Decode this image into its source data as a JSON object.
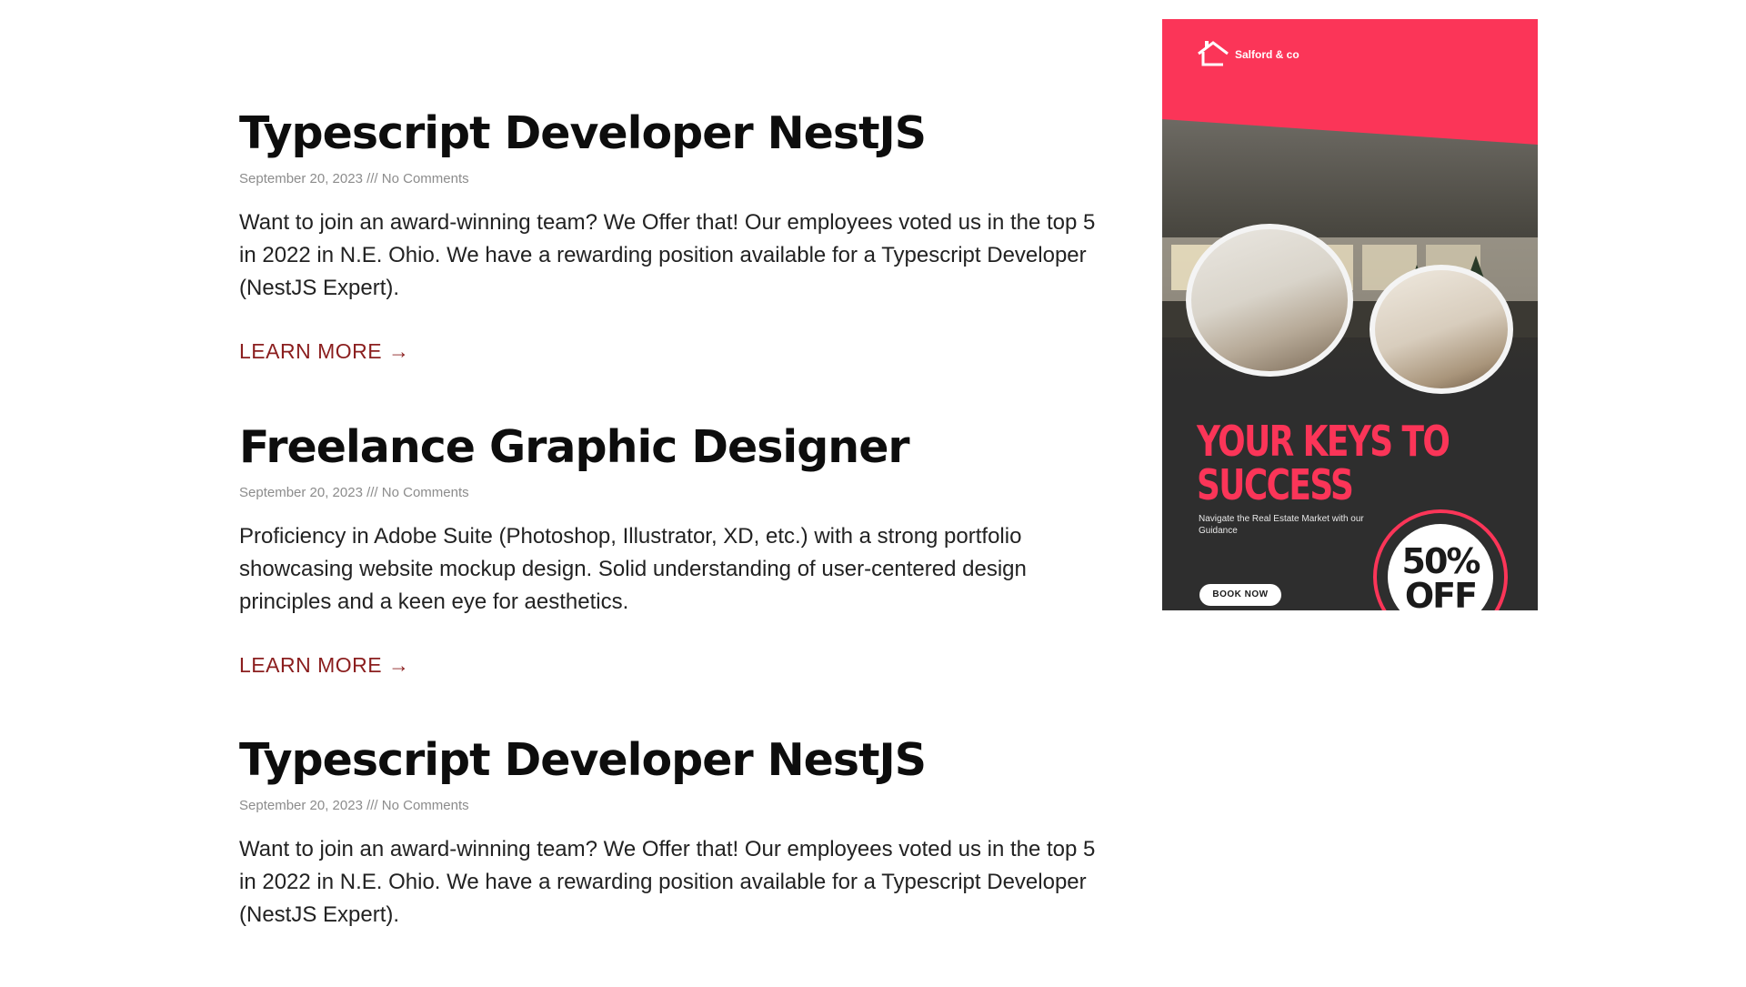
{
  "posts": [
    {
      "title": "Typescript Developer NestJS",
      "meta": "September 20, 2023 /// No Comments",
      "excerpt": "Want to join an award-winning team? We Offer that! Our employees voted us in the top 5 in 2022 in N.E. Ohio. We have a rewarding position available for a Typescript Developer (NestJS Expert).",
      "link": "LEARN MORE →"
    },
    {
      "title": "Freelance Graphic Designer",
      "meta": "September 20, 2023 /// No Comments",
      "excerpt": "Proficiency in Adobe Suite (Photoshop, Illustrator, XD, etc.) with a strong portfolio showcasing website mockup design. Solid understanding of user-centered design principles and a keen eye for aesthetics.",
      "link": "LEARN MORE →"
    },
    {
      "title": "Typescript Developer NestJS",
      "meta": "September 20, 2023 /// No Comments",
      "excerpt": "Want to join an award-winning team? We Offer that! Our employees voted us in the top 5 in 2022 in N.E. Ohio. We have a rewarding position available for a Typescript Developer (NestJS Expert)."
    }
  ],
  "ad": {
    "brand": "Salford & co",
    "headline": "YOUR KEYS TO\nSUCCESS",
    "subtext": "Navigate the Real Estate Market with our Guidance",
    "button": "BOOK NOW",
    "badge": "50%\nOFF",
    "colors": {
      "accent": "#fb3558",
      "dark": "#2e2e2e",
      "link": "#8b1e1e"
    },
    "icons": {
      "logo": "house-logo-icon"
    }
  }
}
